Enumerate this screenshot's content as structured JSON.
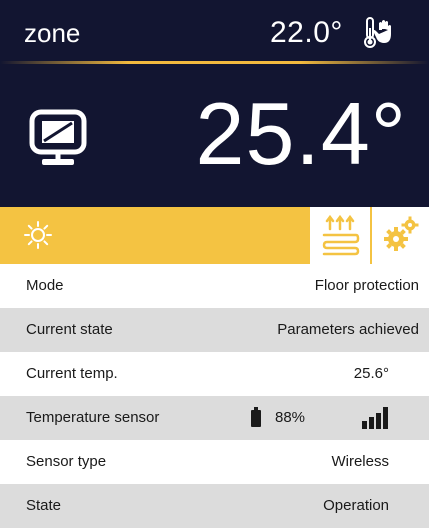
{
  "header": {
    "zone_name": "zone",
    "setpoint": "22.0°",
    "current_temperature": "25.4°",
    "icons": {
      "thermometer": "thermometer-hand-icon",
      "monitor": "monitor-icon"
    }
  },
  "mode_bar": {
    "icons": [
      "sun-icon",
      "floor-heating-icon",
      "gears-icon"
    ],
    "accent_color": "#f4c342"
  },
  "rows": [
    {
      "label": "Mode",
      "value": "Floor protection"
    },
    {
      "label": "Current state",
      "value": "Parameters achieved"
    },
    {
      "label": "Current temp.",
      "value": "25.6°"
    },
    {
      "label": "Temperature sensor",
      "battery": "88%"
    },
    {
      "label": "Sensor type",
      "value": "Wireless"
    },
    {
      "label": "State",
      "value": "Operation"
    }
  ],
  "colors": {
    "header_bg": "#121531",
    "alt_row_bg": "#dcdcdc"
  }
}
